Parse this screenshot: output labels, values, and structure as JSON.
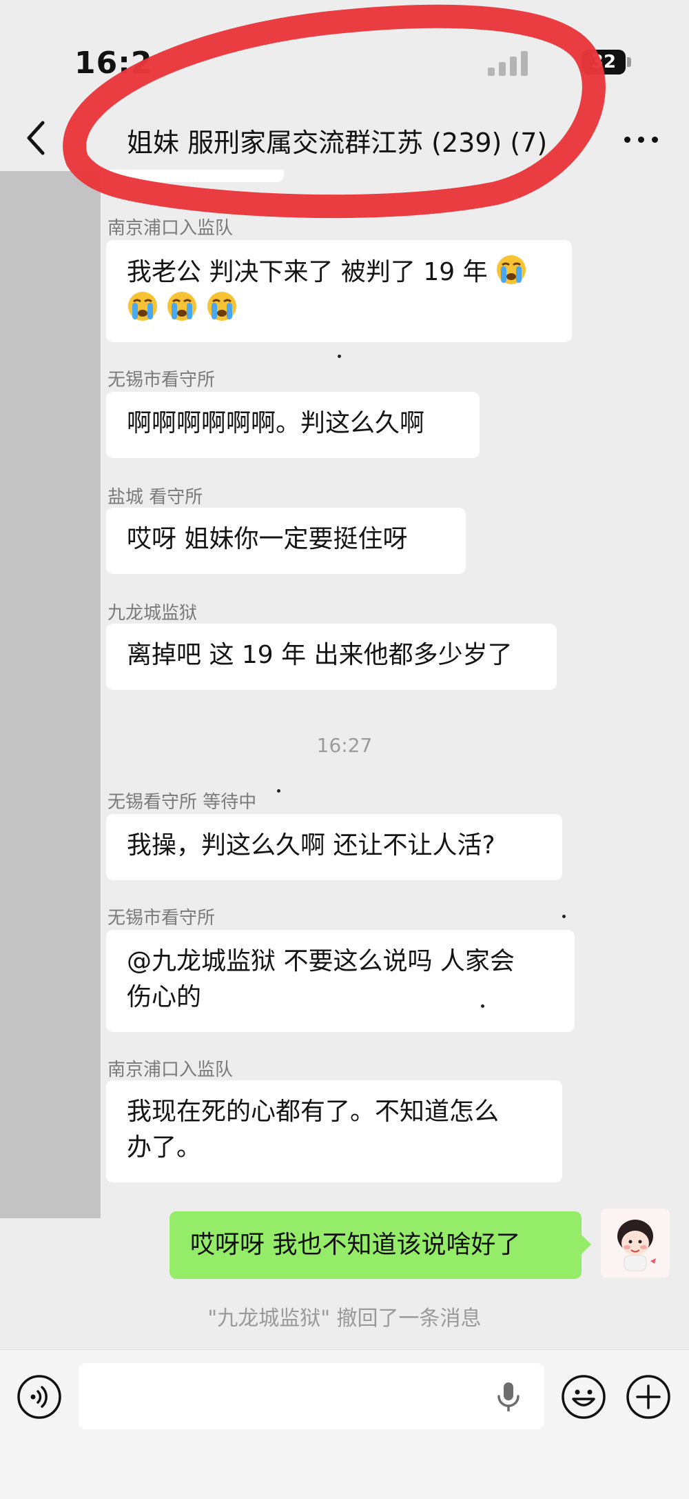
{
  "status_bar": {
    "time": "16:2",
    "battery": "32"
  },
  "nav": {
    "title": "姐妹 服刑家属交流群江苏 (239) (7)"
  },
  "messages": [
    {
      "sender": "南京浦口入监队",
      "line1": "我老公 判决下来了  被判了 19 年",
      "emoji": "crying-face"
    },
    {
      "sender": "无锡市看守所",
      "text": "啊啊啊啊啊啊。判这么久啊"
    },
    {
      "sender": "盐城 看守所",
      "text": "哎呀 姐妹你一定要挺住呀"
    },
    {
      "sender": "九龙城监狱",
      "text": "离掉吧 这 19 年 出来他都多少岁了"
    },
    {
      "sender": "无锡看守所 等待中",
      "text": "我操，判这么久啊  还让不让人活?"
    },
    {
      "sender": "无锡市看守所",
      "line1": "@九龙城监狱 不要这么说吗 人家会",
      "line2": "伤心的"
    },
    {
      "sender": "南京浦口入监队",
      "line1": "我现在死的心都有了。不知道怎么",
      "line2": "办了。"
    }
  ],
  "timestamp": "16:27",
  "my_message": {
    "text": "哎呀呀 我也不知道该说啥好了"
  },
  "recall_notice": "\"九龙城监狱\" 撤回了一条消息",
  "icons": {
    "back": "chevron-left-icon",
    "more": "more-dots-icon",
    "voice": "voice-toggle-icon",
    "mic": "microphone-icon",
    "emoji": "emoji-icon",
    "plus": "plus-icon"
  },
  "colors": {
    "background": "#ededed",
    "my_bubble": "#95ec69",
    "marker": "#e8373c"
  }
}
